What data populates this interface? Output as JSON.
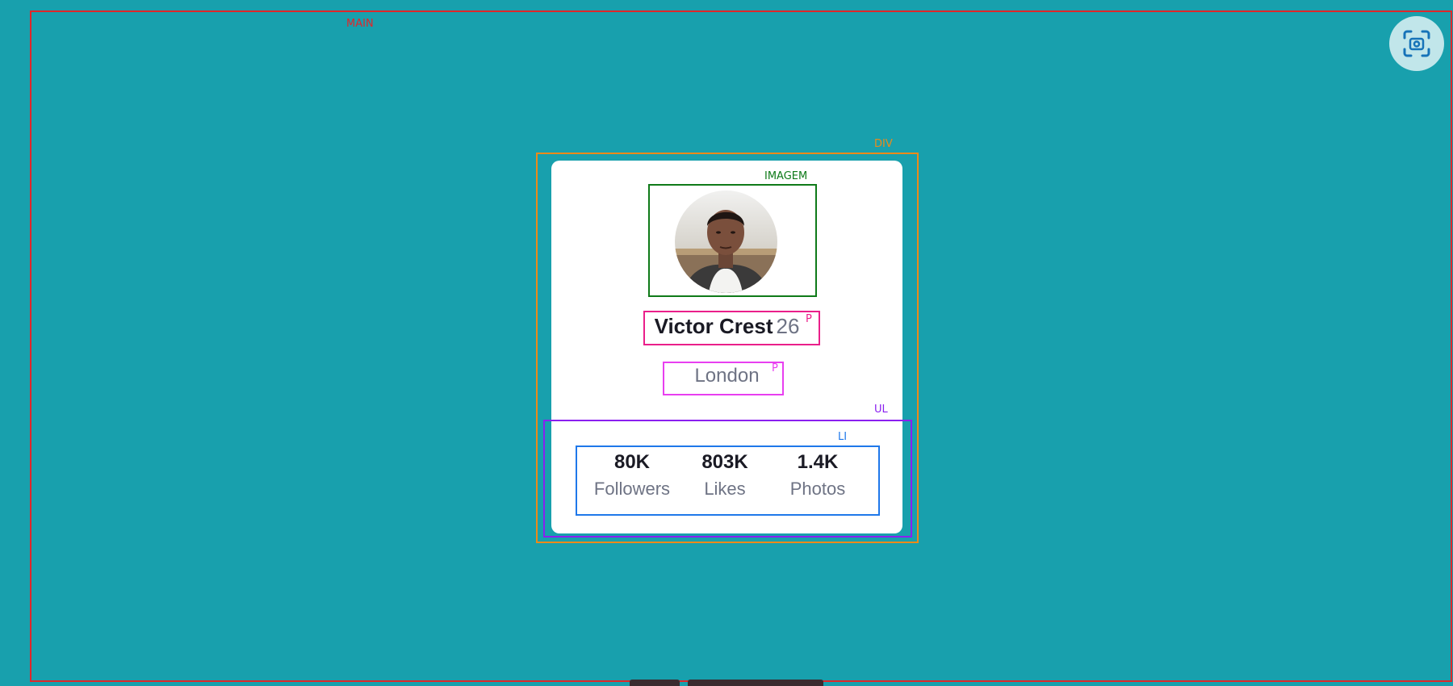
{
  "annotations": {
    "main": "MAIN",
    "div": "DIV",
    "imagem": "IMAGEM",
    "p1": "P",
    "p2": "P",
    "ul": "UL",
    "li": "LI"
  },
  "profile": {
    "name": "Victor Crest",
    "age": "26",
    "city": "London",
    "avatar_icon": "profile-photo"
  },
  "stats": [
    {
      "value": "80K",
      "label": "Followers"
    },
    {
      "value": "803K",
      "label": "Likes"
    },
    {
      "value": "1.4K",
      "label": "Photos"
    }
  ],
  "toolbar": {
    "screenshot_icon": "screenshot-icon"
  },
  "colors": {
    "background": "#18a0ad",
    "card": "#ffffff",
    "main_outline": "#e0272a",
    "div_outline": "#ec8a19",
    "img_outline": "#0f7a19",
    "p_outline": "#ea1f8a",
    "ul_outline": "#8a1ff0",
    "li_outline": "#1f78ea"
  }
}
